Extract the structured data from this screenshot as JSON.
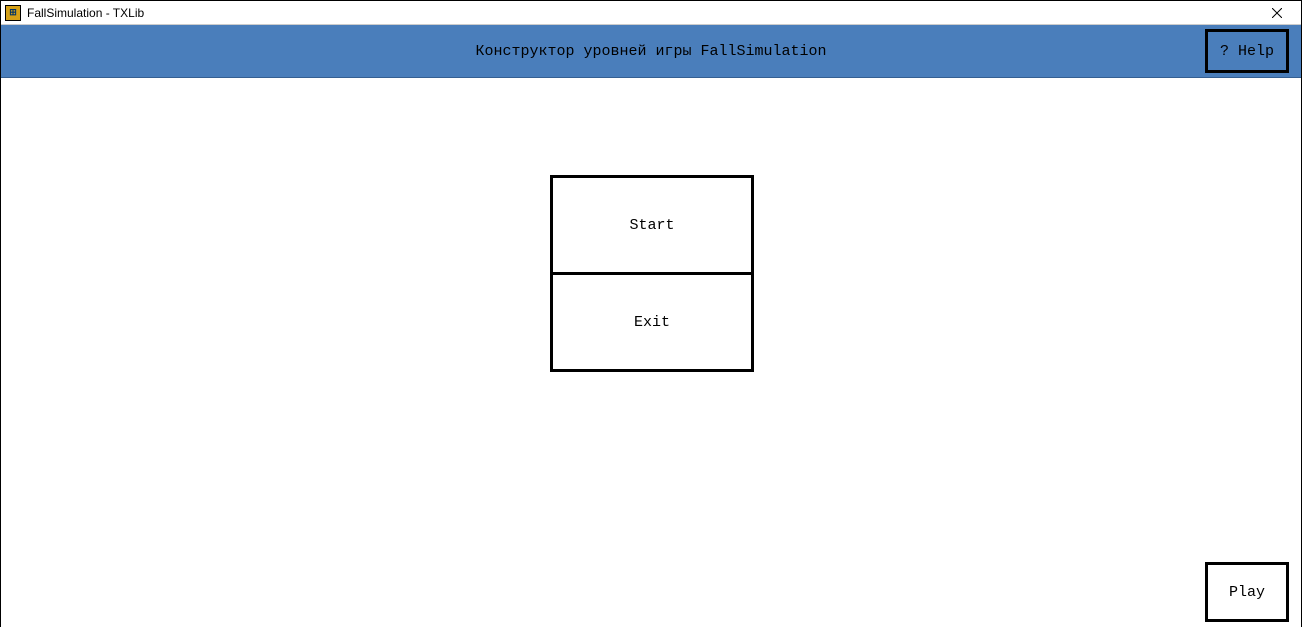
{
  "window": {
    "title": "FallSimulation - TXLib"
  },
  "header": {
    "title": "Конструктор уровней игры FallSimulation",
    "help_label": "? Help"
  },
  "menu": {
    "start_label": "Start",
    "exit_label": "Exit"
  },
  "footer": {
    "play_label": "Play"
  }
}
